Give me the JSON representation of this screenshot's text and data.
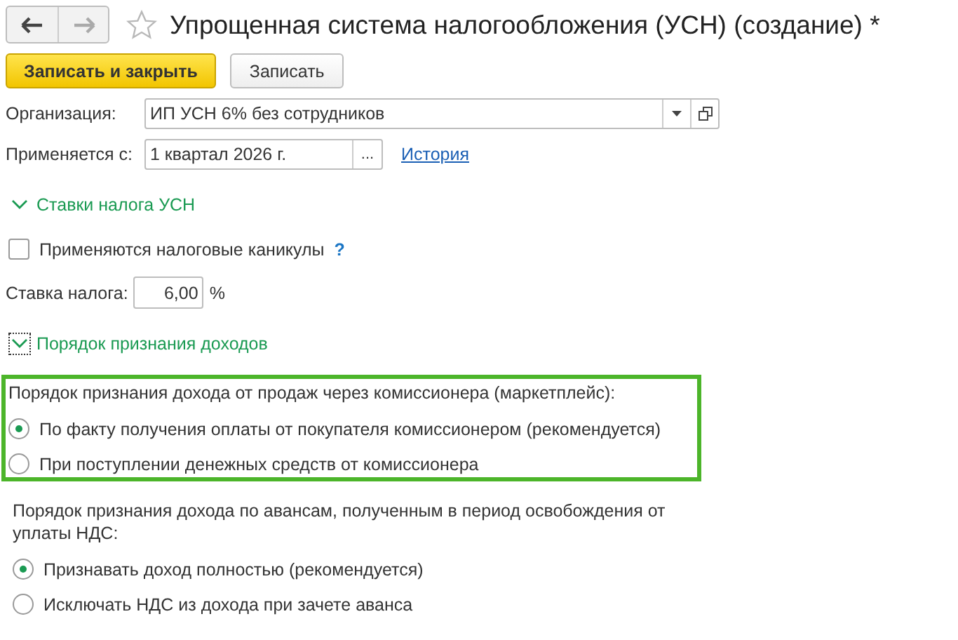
{
  "window": {
    "title": "Упрощенная система налогообложения (УСН) (создание) *",
    "favorite": false
  },
  "nav": {
    "back_enabled": true,
    "forward_enabled": false
  },
  "buttons": [
    {
      "label": "Записать и закрыть",
      "primary": true
    },
    {
      "label": "Записать",
      "primary": false
    }
  ],
  "organization": {
    "label": "Организация:",
    "value": "ИП УСН 6% без сотрудников"
  },
  "applies_from": {
    "label": "Применяется с:",
    "value": "1 квартал 2026 г.",
    "choose": "...",
    "link": "История"
  },
  "rates_section": {
    "title": "Ставки налога УСН",
    "expanded": true,
    "focused": false
  },
  "tax_holidays": {
    "label": "Применяются налоговые каникулы",
    "checked": false,
    "help": "?"
  },
  "rate": {
    "label": "Ставка налога:",
    "value": "6,00",
    "unit": "%"
  },
  "income_section": {
    "title": "Порядок признания доходов",
    "expanded": true,
    "focused": true
  },
  "groups": [
    {
      "title": "Порядок признания дохода от продаж через комиссионера (маркетплейс):",
      "highlighted": true,
      "options": [
        {
          "label": "По факту получения оплаты от покупателя комиссионером (рекомендуется)",
          "selected": true
        },
        {
          "label": "При поступлении денежных средств от комиссионера",
          "selected": false
        }
      ]
    },
    {
      "title": "Порядок признания дохода по авансам, полученным в период освобождения от уплаты НДС:",
      "highlighted": false,
      "options": [
        {
          "label": "Признавать доход полностью (рекомендуется)",
          "selected": true
        },
        {
          "label": "Исключать НДС из дохода при зачете аванса",
          "selected": false
        }
      ]
    }
  ]
}
